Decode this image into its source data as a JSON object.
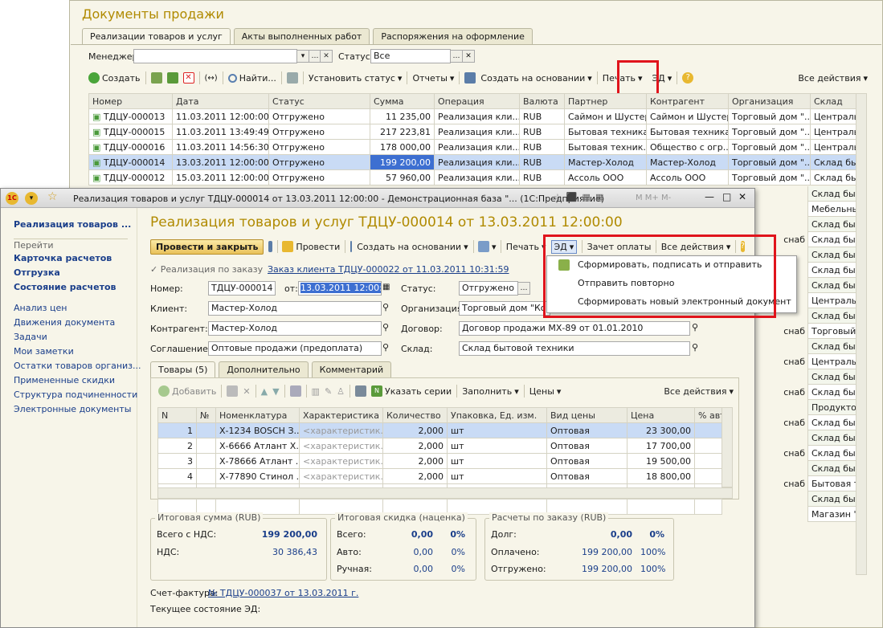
{
  "bg": {
    "title": "Документы продажи",
    "tabs": [
      "Реализации товаров и услуг",
      "Акты выполненных работ",
      "Распоряжения на оформление"
    ],
    "manager_label": "Менеджер:",
    "manager_value": "",
    "status_label": "Статус:",
    "status_value": "Все",
    "toolbar": {
      "create": "Создать",
      "find": "Найти...",
      "set_status": "Установить статус",
      "reports": "Отчеты",
      "create_based": "Создать на основании",
      "print": "Печать",
      "ed": "ЭД",
      "all_actions": "Все действия"
    },
    "columns": [
      "Номер",
      "Дата",
      "Статус",
      "Сумма",
      "Операция",
      "Валюта",
      "Партнер",
      "Контрагент",
      "Организация",
      "Склад"
    ],
    "rows": [
      [
        "ТДЦУ-000013",
        "11.03.2011 12:00:00",
        "Отгружено",
        "11 235,00",
        "Реализация кли...",
        "RUB",
        "Саймон и Шустер",
        "Саймон и Шустер",
        "Торговый дом \"...",
        "Централь"
      ],
      [
        "ТДЦУ-000015",
        "11.03.2011 13:49:49",
        "Отгружено",
        "217 223,81",
        "Реализация кли...",
        "RUB",
        "Бытовая техника",
        "Бытовая техника",
        "Торговый дом \"...",
        "Централь"
      ],
      [
        "ТДЦУ-000016",
        "11.03.2011 14:56:30",
        "Отгружено",
        "178 000,00",
        "Реализация кли...",
        "RUB",
        "Бытовая техник...",
        "Общество с огр...",
        "Торговый дом \"...",
        "Централь"
      ],
      [
        "ТДЦУ-000014",
        "13.03.2011 12:00:00",
        "Отгружено",
        "199 200,00",
        "Реализация кли...",
        "RUB",
        "Мастер-Холод",
        "Мастер-Холод",
        "Торговый дом \"...",
        "Склад быт"
      ],
      [
        "ТДЦУ-000012",
        "15.03.2011 12:00:00",
        "Отгружено",
        "57 960,00",
        "Реализация кли...",
        "RUB",
        "Ассоль ООО",
        "Ассоль ООО",
        "Торговый дом \"...",
        "Склад быт"
      ]
    ],
    "right_col": [
      "Склад быт",
      "Мебельны",
      "Склад быт",
      "Склад быт",
      "Склад быт",
      "Склад быт",
      "Склад быт",
      "Централь",
      "Склад быт",
      "Торговый",
      "Склад быт",
      "Централь",
      "Склад быт",
      "Склад быт",
      "Продукто",
      "Склад быт",
      "Склад быт",
      "Склад быт",
      "Склад быт",
      "Бытовая т",
      "Склад быт",
      "Магазин \""
    ],
    "right_col2": [
      "снаб",
      "снаб",
      "снаб",
      "снаб",
      "снаб",
      "снаб",
      "снаб"
    ]
  },
  "fg": {
    "window_title": "Реализация товаров и услуг ТДЦУ-000014 от 13.03.2011 12:00:00 - Демонстрационная база \"... (1С:Предприятие)",
    "nav_title": "Реализация товаров ...",
    "nav_section": "Перейти",
    "nav_bold": [
      "Карточка расчетов",
      "Отгрузка",
      "Состояние расчетов"
    ],
    "nav_links": [
      "Анализ цен",
      "Движения документа",
      "Задачи",
      "Мои заметки",
      "Остатки товаров организ...",
      "Примененные скидки",
      "Структура подчиненности",
      "Электронные документы"
    ],
    "heading": "Реализация товаров и услуг ТДЦУ-000014 от 13.03.2011 12:00:00",
    "toolbar": {
      "post_close": "Провести и закрыть",
      "post": "Провести",
      "create_based": "Создать на основании",
      "print": "Печать",
      "ed": "ЭД",
      "payment": "Зачет оплаты",
      "all_actions": "Все действия"
    },
    "by_order": "Реализация по заказу",
    "order_link": "Заказ клиента ТДЦУ-000022 от 11.03.2011 10:31:59",
    "number_label": "Номер:",
    "number": "ТДЦУ-000014",
    "from_label": "от:",
    "date": "13.03.2011 12:00:00",
    "status_label": "Статус:",
    "status": "Отгружено",
    "client_label": "Клиент:",
    "client": "Мастер-Холод",
    "org_label": "Организация:",
    "org": "Торговый дом \"Комп",
    "contr_label": "Контрагент:",
    "contr": "Мастер-Холод",
    "contract_label": "Договор:",
    "contract": "Договор продажи МХ-89 от 01.01.2010",
    "agreement_label": "Соглашение:",
    "agreement": "Оптовые продажи (предоплата)",
    "warehouse_label": "Склад:",
    "warehouse": "Склад бытовой техники",
    "tabs": [
      "Товары (5)",
      "Дополнительно",
      "Комментарий"
    ],
    "goods_tb": {
      "add": "Добавить",
      "series": "Указать серии",
      "fill": "Заполнить",
      "prices": "Цены",
      "all_actions": "Все действия"
    },
    "goods_cols": [
      "N",
      "№",
      "Номенклатура",
      "Характеристика",
      "Количество",
      "Упаковка, Ед. изм.",
      "Вид цены",
      "Цена",
      "% авт."
    ],
    "goods_rows": [
      [
        "1",
        "",
        "Х-1234 BOSCH З...",
        "<характеристик...",
        "2,000",
        "шт",
        "Оптовая",
        "23 300,00",
        ""
      ],
      [
        "2",
        "",
        "Х-6666 Атлант Х...",
        "<характеристик...",
        "2,000",
        "шт",
        "Оптовая",
        "17 700,00",
        ""
      ],
      [
        "3",
        "",
        "Х-78666 Атлант ...",
        "<характеристик...",
        "2,000",
        "шт",
        "Оптовая",
        "19 500,00",
        ""
      ],
      [
        "4",
        "",
        "Х-77890 Стинол ...",
        "<характеристик...",
        "2,000",
        "шт",
        "Оптовая",
        "18 800,00",
        ""
      ]
    ],
    "totals": {
      "title1": "Итоговая сумма (RUB)",
      "total_vat_label": "Всего с НДС:",
      "total_vat": "199 200,00",
      "vat_label": "НДС:",
      "vat": "30 386,43",
      "title2": "Итоговая скидка (наценка)",
      "d_total_label": "Всего:",
      "d_total": "0,00",
      "d_total_pct": "0%",
      "d_auto_label": "Авто:",
      "d_auto": "0,00",
      "d_auto_pct": "0%",
      "d_manual_label": "Ручная:",
      "d_manual": "0,00",
      "d_manual_pct": "0%",
      "title3": "Расчеты по заказу (RUB)",
      "debt_label": "Долг:",
      "debt": "0,00",
      "debt_pct": "0%",
      "paid_label": "Оплачено:",
      "paid": "199 200,00",
      "paid_pct": "100%",
      "shipped_label": "Отгружено:",
      "shipped": "199 200,00",
      "shipped_pct": "100%"
    },
    "invoice_label": "Счет-фактура:",
    "invoice_link": "№ ТДЦУ-000037 от 13.03.2011 г.",
    "ed_state_label": "Текущее состояние ЭД:",
    "dropdown": [
      "Сформировать, подписать и отправить",
      "Отправить повторно",
      "Сформировать новый электронный документ"
    ]
  }
}
